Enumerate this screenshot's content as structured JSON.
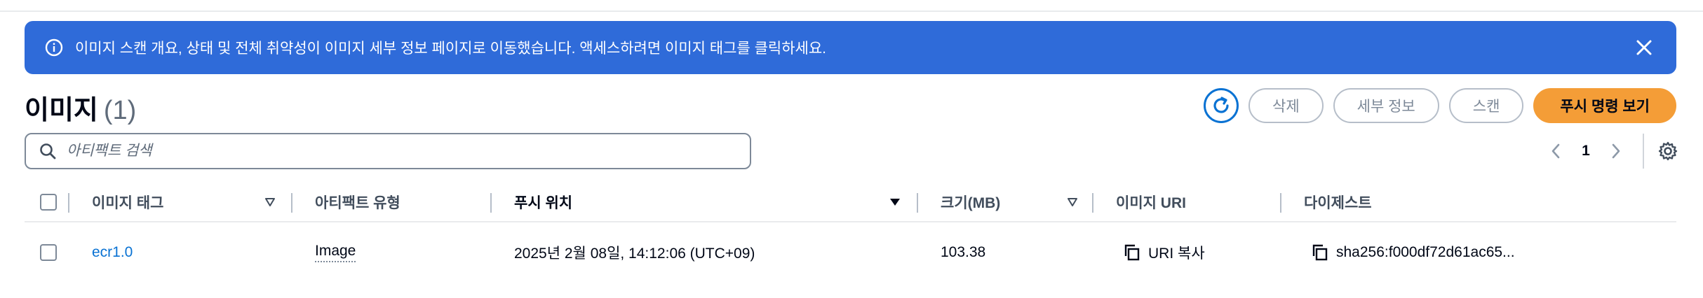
{
  "flash": {
    "message": "이미지 스캔 개요, 상태 및 전체 취약성이 이미지 세부 정보 페이지로 이동했습니다. 액세스하려면 이미지 태그를 클릭하세요.",
    "color": "#2f6bd9"
  },
  "header": {
    "title": "이미지",
    "count": "(1)"
  },
  "actions": {
    "delete": "삭제",
    "details": "세부 정보",
    "scan": "스캔",
    "push_commands": "푸시 명령 보기"
  },
  "search": {
    "placeholder": "아티팩트 검색"
  },
  "pagination": {
    "current_page": "1"
  },
  "table": {
    "columns": {
      "image_tag": "이미지 태그",
      "artifact_type": "아티팩트 유형",
      "pushed_at": "푸시 위치",
      "size": "크기(MB)",
      "image_uri": "이미지 URI",
      "digest": "다이제스트"
    },
    "rows": [
      {
        "image_tag": "ecr1.0",
        "artifact_type": "Image",
        "pushed_at": "2025년 2월 08일, 14:12:06 (UTC+09)",
        "size": "103.38",
        "copy_uri": "URI 복사",
        "digest": "sha256:f000df72d61ac65..."
      }
    ]
  },
  "colors": {
    "accent": "#0972d3",
    "primary_button": "#f49d37"
  }
}
